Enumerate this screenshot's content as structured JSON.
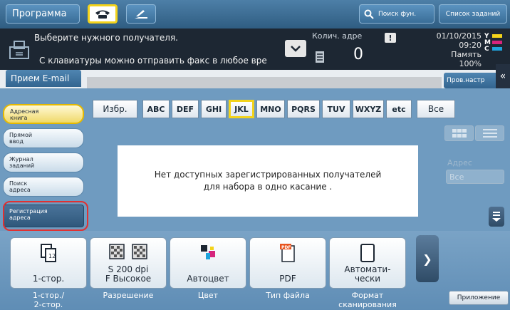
{
  "topbar": {
    "program_label": "Программа",
    "search_label": "Поиск фун.",
    "jobs_label": "Список заданий"
  },
  "message": {
    "line1": "Выберите нужного получателя.",
    "line2": "С клавиатуры можно отправить факс в любое вре",
    "count_label": "Колич. адре",
    "count_value": "0",
    "warning_symbol": "!",
    "date": "01/10/2015",
    "time": "09:20",
    "memory_label": "Память",
    "memory_value": "100%",
    "toner": [
      {
        "label": "Y",
        "color": "#f3d31b"
      },
      {
        "label": "M",
        "color": "#d6247c"
      },
      {
        "label": "C",
        "color": "#1fa3dc"
      }
    ]
  },
  "email_tab_label": "Прием E-mail",
  "settings_label": "Пров.настр",
  "sidebar": {
    "items": [
      {
        "label_line1": "Адресная",
        "label_line2": "книга"
      },
      {
        "label_line1": "Прямой",
        "label_line2": "ввод"
      },
      {
        "label_line1": "Журнал",
        "label_line2": "заданий"
      },
      {
        "label_line1": "Поиск",
        "label_line2": "адреса"
      },
      {
        "label_line1": "Регистрация",
        "label_line2": "адреса"
      }
    ]
  },
  "index": {
    "favorites": "Избр.",
    "letters": [
      "ABC",
      "DEF",
      "GHI",
      "JKL",
      "MNO",
      "PQRS",
      "TUV",
      "WXYZ",
      "etc"
    ],
    "all": "Все",
    "selected": "JKL"
  },
  "address_select": {
    "label": "Адрес",
    "value": "Все"
  },
  "empty_message": {
    "line1": "Нет доступных зарегистрированных получателей",
    "line2": "для набора в одно касание ."
  },
  "functions": [
    {
      "value": "1-стор.",
      "caption_line1": "1-стор./",
      "caption_line2": "2-стор.",
      "icon": "duplex-icon"
    },
    {
      "value": "S 200 dpi",
      "value_line2": "F Высокое",
      "caption_line1": "Разрешение",
      "caption_line2": "",
      "icon": "resolution-icon"
    },
    {
      "value": "Автоцвет",
      "caption_line1": "Цвет",
      "caption_line2": "",
      "icon": "color-icon"
    },
    {
      "value": "PDF",
      "caption_line1": "Тип файла",
      "caption_line2": "",
      "icon": "pdf-icon"
    },
    {
      "value": "Автомати-",
      "value_line2": "чески",
      "caption_line1": "Формат",
      "caption_line2": "сканирования",
      "icon": "document-icon"
    }
  ],
  "app_button_label": "Приложение"
}
